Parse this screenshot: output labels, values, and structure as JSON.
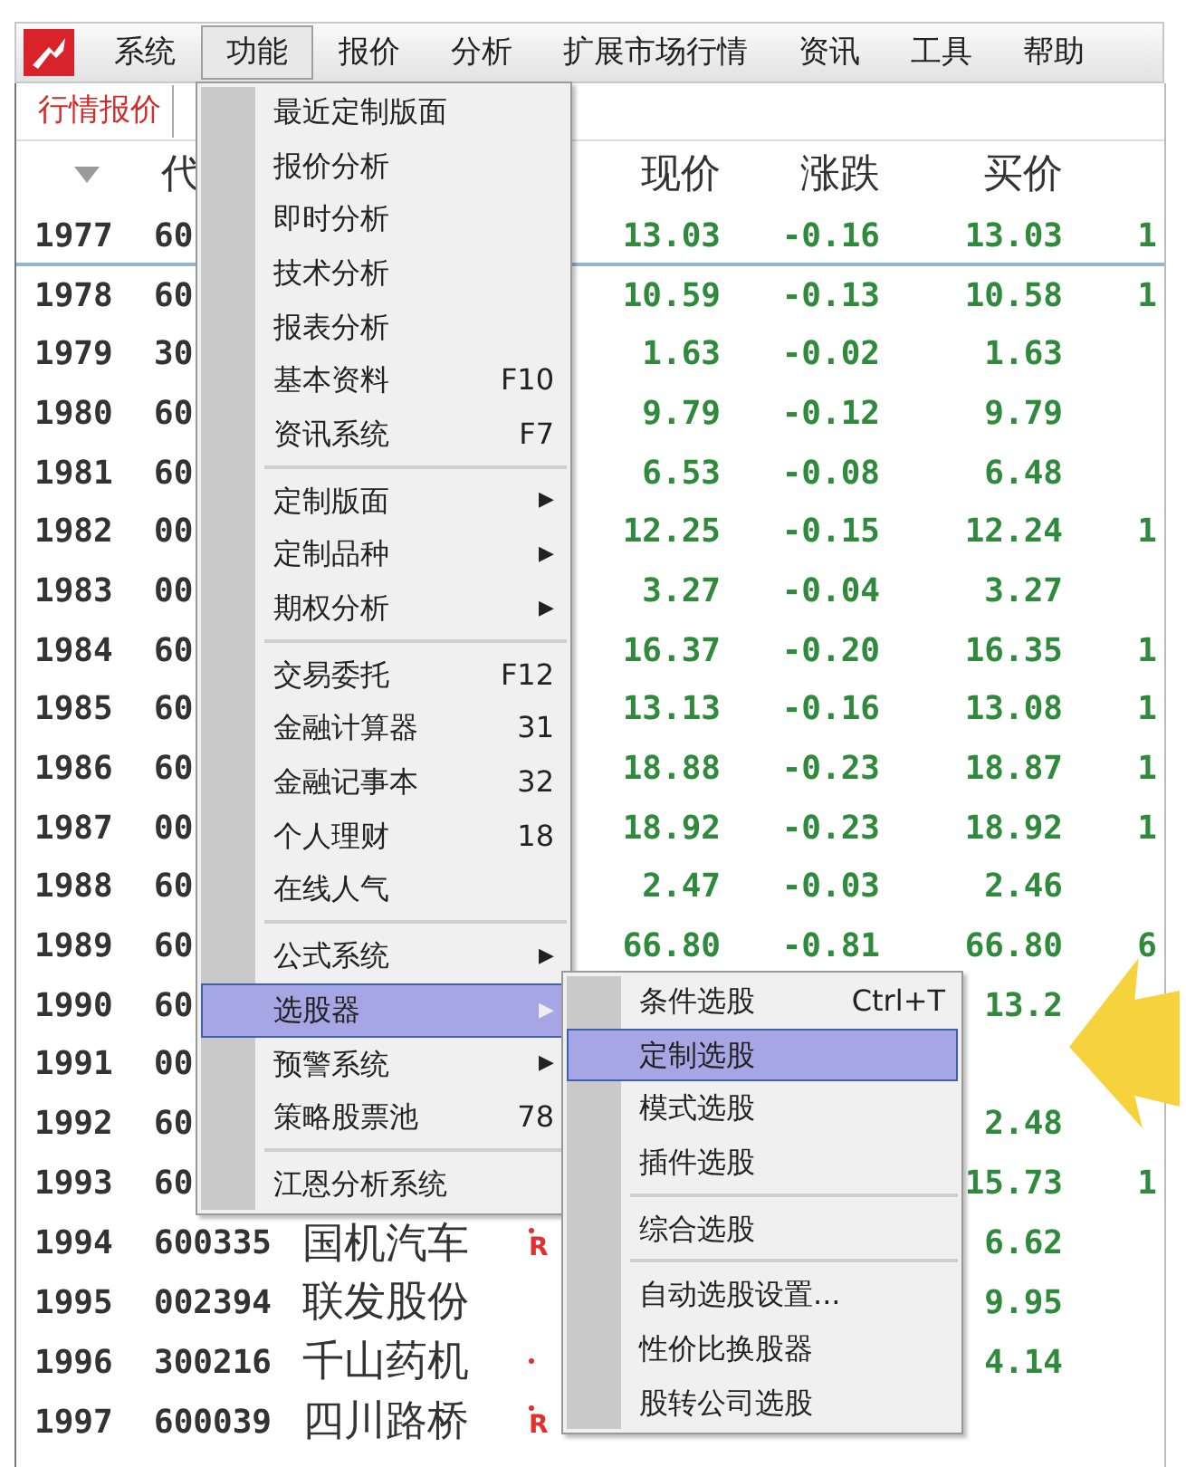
{
  "menubar": [
    {
      "label": "系统",
      "selected": false
    },
    {
      "label": "功能",
      "selected": true
    },
    {
      "label": "报价",
      "selected": false
    },
    {
      "label": "分析",
      "selected": false
    },
    {
      "label": "扩展市场行情",
      "selected": false
    },
    {
      "label": "资讯",
      "selected": false
    },
    {
      "label": "工具",
      "selected": false
    },
    {
      "label": "帮助",
      "selected": false
    }
  ],
  "tabs": [
    {
      "label": "行情报价",
      "selected": true
    }
  ],
  "table": {
    "columns": [
      "代",
      "现价",
      "涨跌",
      "买价"
    ],
    "rows": [
      {
        "rank": "1977",
        "code": "60",
        "price": "13.03",
        "change": "-0.16",
        "bid": "13.03",
        "column_4": "1",
        "selected": true
      },
      {
        "rank": "1978",
        "code": "60",
        "price": "10.59",
        "change": "-0.13",
        "bid": "10.58",
        "column_4": "1",
        "selected": false
      },
      {
        "rank": "1979",
        "code": "30",
        "price": "1.63",
        "change": "-0.02",
        "bid": "1.63",
        "selected": false
      },
      {
        "rank": "1980",
        "code": "60",
        "price": "9.79",
        "change": "-0.12",
        "bid": "9.79",
        "selected": false
      },
      {
        "rank": "1981",
        "code": "60",
        "price": "6.53",
        "change": "-0.08",
        "bid": "6.48",
        "selected": false
      },
      {
        "rank": "1982",
        "code": "00",
        "price": "12.25",
        "change": "-0.15",
        "bid": "12.24",
        "column_4": "1",
        "selected": false
      },
      {
        "rank": "1983",
        "code": "00",
        "price": "3.27",
        "change": "-0.04",
        "bid": "3.27",
        "selected": false
      },
      {
        "rank": "1984",
        "code": "60",
        "price": "16.37",
        "change": "-0.20",
        "bid": "16.35",
        "column_4": "1",
        "selected": false
      },
      {
        "rank": "1985",
        "code": "60",
        "price": "13.13",
        "change": "-0.16",
        "bid": "13.08",
        "column_4": "1",
        "selected": false
      },
      {
        "rank": "1986",
        "code": "60",
        "price": "18.88",
        "change": "-0.23",
        "bid": "18.87",
        "column_4": "1",
        "selected": false
      },
      {
        "rank": "1987",
        "code": "00",
        "price": "18.92",
        "change": "-0.23",
        "bid": "18.92",
        "column_4": "1",
        "selected": false
      },
      {
        "rank": "1988",
        "code": "60",
        "price": "2.47",
        "change": "-0.03",
        "bid": "2.46",
        "selected": false
      },
      {
        "rank": "1989",
        "code": "60",
        "price": "66.80",
        "change": "-0.81",
        "bid": "66.80",
        "column_4": "6",
        "selected": false
      },
      {
        "rank": "1990",
        "code": "60",
        "bid": "13.2",
        "selected": false
      },
      {
        "rank": "1991",
        "code": "00",
        "selected": false
      },
      {
        "rank": "1992",
        "code": "60",
        "bid": "2.48",
        "selected": false
      },
      {
        "rank": "1993",
        "code": "60",
        "bid": "15.73",
        "column_4": "1",
        "selected": false
      },
      {
        "rank": "1994",
        "code": "600335",
        "name": "国机汽车",
        "tag": "R",
        "dot": true,
        "bid": "6.62",
        "selected": false
      },
      {
        "rank": "1995",
        "code": "002394",
        "name": "联发股份",
        "bid": "9.95",
        "selected": false
      },
      {
        "rank": "1996",
        "code": "300216",
        "name": "千山药机",
        "dot": true,
        "bid": "4.14",
        "selected": false
      },
      {
        "rank": "1997",
        "code": "600039",
        "name": "四川路桥",
        "tag": "R",
        "dot": true,
        "selected": false
      }
    ]
  },
  "menu": [
    {
      "kind": "item",
      "label": "最近定制版面",
      "selected": false
    },
    {
      "kind": "item",
      "label": "报价分析",
      "selected": false
    },
    {
      "kind": "item",
      "label": "即时分析",
      "selected": false
    },
    {
      "kind": "item",
      "label": "技术分析",
      "selected": false
    },
    {
      "kind": "item",
      "label": "报表分析",
      "selected": false
    },
    {
      "kind": "item",
      "label": "基本资料",
      "shortcut": "F10",
      "selected": false
    },
    {
      "kind": "item",
      "label": "资讯系统",
      "shortcut": "F7",
      "selected": false
    },
    {
      "kind": "separator"
    },
    {
      "kind": "item",
      "label": "定制版面",
      "arrow": "▶",
      "selected": false
    },
    {
      "kind": "item",
      "label": "定制品种",
      "arrow": "▶",
      "selected": false
    },
    {
      "kind": "item",
      "label": "期权分析",
      "arrow": "▶",
      "selected": false
    },
    {
      "kind": "separator"
    },
    {
      "kind": "item",
      "label": "交易委托",
      "shortcut": "F12",
      "selected": false
    },
    {
      "kind": "item",
      "label": "金融计算器",
      "shortcut": "31",
      "selected": false
    },
    {
      "kind": "item",
      "label": "金融记事本",
      "shortcut": "32",
      "selected": false
    },
    {
      "kind": "item",
      "label": "个人理财",
      "shortcut": "18",
      "selected": false
    },
    {
      "kind": "item",
      "label": "在线人气",
      "selected": false
    },
    {
      "kind": "separator"
    },
    {
      "kind": "item",
      "label": "公式系统",
      "arrow": "▶",
      "selected": false
    },
    {
      "kind": "item",
      "label": "选股器",
      "arrow": "▶",
      "selected": true
    },
    {
      "kind": "item",
      "label": "预警系统",
      "arrow": "▶",
      "selected": false
    },
    {
      "kind": "item",
      "label": "策略股票池",
      "shortcut": "78",
      "selected": false
    },
    {
      "kind": "separator"
    },
    {
      "kind": "item",
      "label": "江恩分析系统",
      "selected": false
    }
  ],
  "submenu": [
    {
      "kind": "item",
      "label": "条件选股",
      "shortcut": "Ctrl+T",
      "selected": false
    },
    {
      "kind": "item",
      "label": "定制选股",
      "selected": true
    },
    {
      "kind": "item",
      "label": "模式选股",
      "selected": false
    },
    {
      "kind": "item",
      "label": "插件选股",
      "selected": false
    },
    {
      "kind": "separator"
    },
    {
      "kind": "item",
      "label": "综合选股",
      "selected": false
    },
    {
      "kind": "separator"
    },
    {
      "kind": "item",
      "label": "自动选股设置...",
      "selected": false
    },
    {
      "kind": "item",
      "label": "性价比换股器",
      "selected": false
    },
    {
      "kind": "item",
      "label": "股转公司选股",
      "selected": false
    }
  ]
}
